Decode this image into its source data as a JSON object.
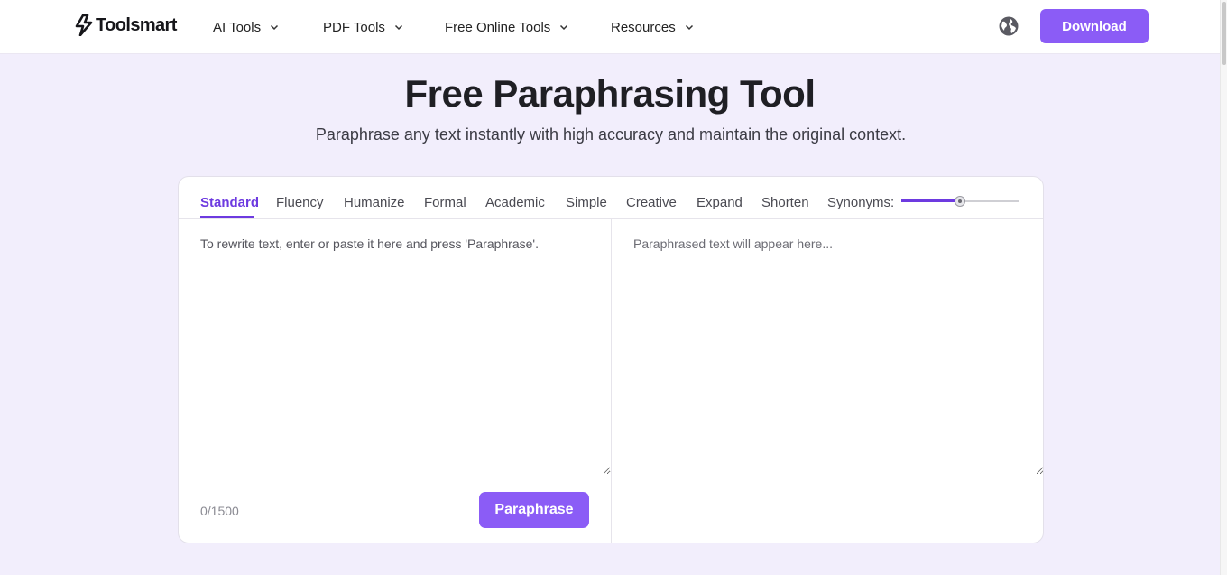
{
  "header": {
    "logo_text": "Toolsmart",
    "nav": [
      {
        "label": "AI Tools"
      },
      {
        "label": "PDF Tools"
      },
      {
        "label": "Free Online Tools"
      },
      {
        "label": "Resources"
      }
    ],
    "download_label": "Download",
    "accent_color": "#8b5cf6"
  },
  "hero": {
    "title": "Free Paraphrasing Tool",
    "subtitle": "Paraphrase any text instantly with high accuracy and maintain the original context."
  },
  "tool": {
    "modes": [
      "Standard",
      "Fluency",
      "Humanize",
      "Formal",
      "Academic",
      "Simple",
      "Creative",
      "Expand",
      "Shorten"
    ],
    "active_mode": "Standard",
    "synonyms_label": "Synonyms:",
    "synonyms_level": 0.5,
    "input_placeholder": "To rewrite text, enter or paste it here and press 'Paraphrase'.",
    "input_value": "",
    "output_placeholder": "Paraphrased text will appear here...",
    "counter": "0/1500",
    "paraphrase_label": "Paraphrase",
    "active_color": "#6d3ae0"
  }
}
